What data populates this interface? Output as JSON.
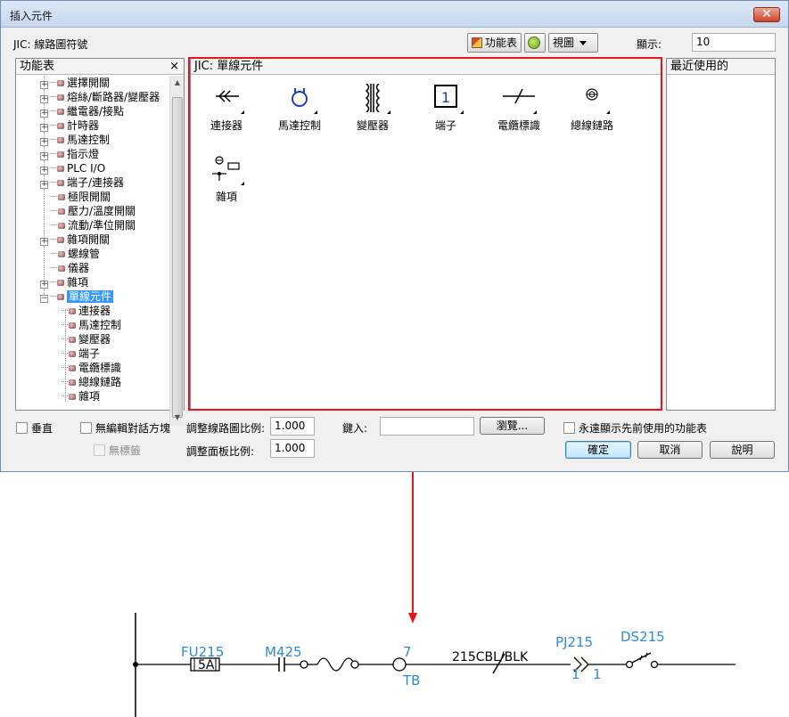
{
  "window": {
    "title": "插入元件",
    "close_label": "✕"
  },
  "toolbar": {
    "menu_path": "JIC: 線路圖符號",
    "menu_button": "功能表",
    "view_button": "視圖",
    "display_label": "顯示:",
    "display_value": "10"
  },
  "tree_panel": {
    "title": "功能表",
    "close": "×",
    "items": [
      {
        "label": "選擇開關",
        "expander": "+"
      },
      {
        "label": "熔絲/斷路器/變壓器",
        "expander": "+"
      },
      {
        "label": "繼電器/接點",
        "expander": "+"
      },
      {
        "label": "計時器",
        "expander": "+"
      },
      {
        "label": "馬達控制",
        "expander": "+"
      },
      {
        "label": "指示燈",
        "expander": "+"
      },
      {
        "label": "PLC I/O",
        "expander": "+"
      },
      {
        "label": "端子/連接器",
        "expander": "+"
      },
      {
        "label": "極限開關",
        "expander": ""
      },
      {
        "label": "壓力/溫度開關",
        "expander": ""
      },
      {
        "label": "流動/準位開關",
        "expander": ""
      },
      {
        "label": "雜項開關",
        "expander": "+"
      },
      {
        "label": "螺線管",
        "expander": ""
      },
      {
        "label": "儀器",
        "expander": ""
      },
      {
        "label": "雜項",
        "expander": "+"
      },
      {
        "label": "單線元件",
        "expander": "−",
        "selected": true
      }
    ],
    "children": [
      "連接器",
      "馬達控制",
      "變壓器",
      "端子",
      "電纜標識",
      "總線鏈路",
      "雜項"
    ]
  },
  "icons_panel": {
    "title": "JIC: 單線元件",
    "items": [
      {
        "label": "連接器",
        "icon": "connector-icon"
      },
      {
        "label": "馬達控制",
        "icon": "motor-control-icon"
      },
      {
        "label": "變壓器",
        "icon": "transformer-icon"
      },
      {
        "label": "端子",
        "icon": "terminal-icon",
        "glyph": "1"
      },
      {
        "label": "電纜標識",
        "icon": "cable-marker-icon"
      },
      {
        "label": "總線鏈路",
        "icon": "bus-link-icon"
      },
      {
        "label": "雜項",
        "icon": "misc-icon"
      }
    ]
  },
  "recent_panel": {
    "title": "最近使用的"
  },
  "options": {
    "vertical": "垂直",
    "no_edit_dialog": "無編輯對話方塊",
    "no_tag": "無標籤",
    "schematic_scale_label": "調整線路圖比例:",
    "schematic_scale_value": "1.000",
    "panel_scale_label": "調整面板比例:",
    "panel_scale_value": "1.000",
    "type_label": "鍵入:",
    "type_value": "",
    "browse": "瀏覽...",
    "always_show_recent": "永遠顯示先前使用的功能表",
    "ok": "確定",
    "cancel": "取消",
    "help": "說明"
  },
  "schematic": {
    "fuse_tag": "FU215",
    "fuse_rating": "5A",
    "motor_tag": "M425",
    "terminal_number": "7",
    "terminal_tag": "TB",
    "cable_label": "215CBL/BLK",
    "connector_tag": "PJ215",
    "connector_pin_left": "1",
    "connector_pin_right": "1",
    "switch_tag": "DS215",
    "colors": {
      "annotation": "#2b8bd6",
      "arrow": "#e8141a"
    }
  }
}
